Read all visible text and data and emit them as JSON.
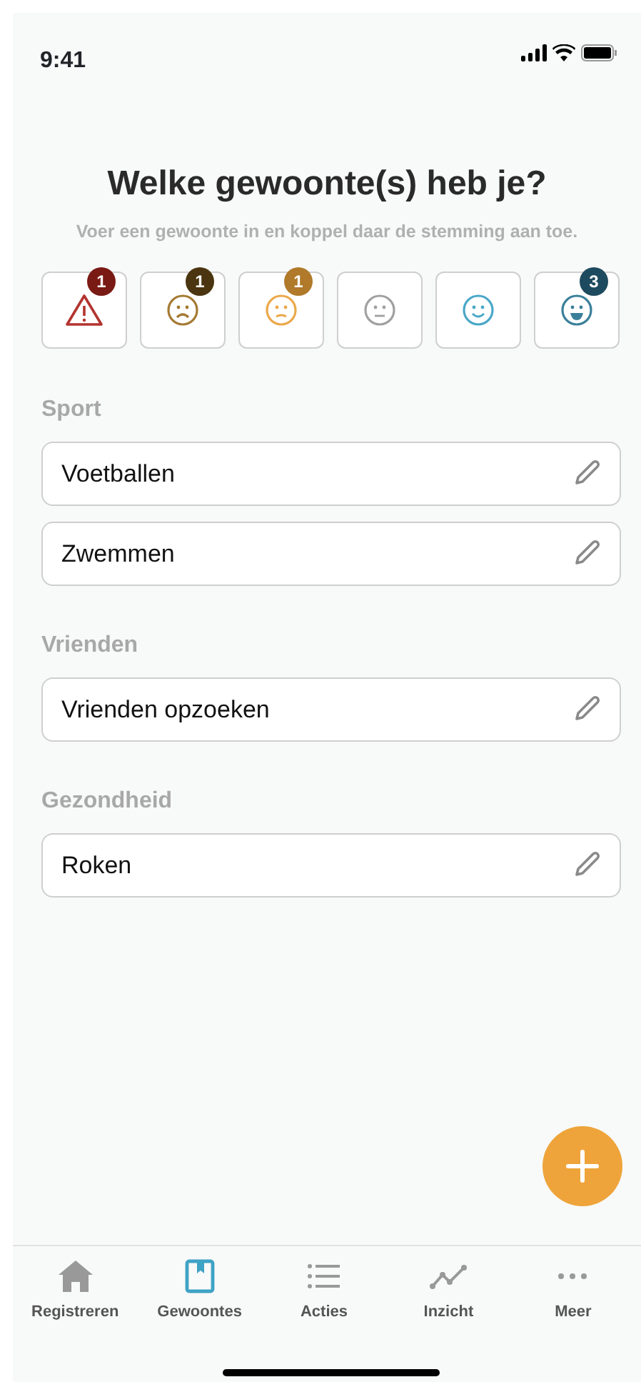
{
  "status_bar": {
    "time": "9:41"
  },
  "title": "Welke gewoonte(s) heb je?",
  "subtitle": "Voer een gewoonte in en koppel daar de stemming aan toe.",
  "moods": [
    {
      "kind": "alert",
      "color": "#b3332e",
      "badge": {
        "count": "1",
        "color": "#7a1a14"
      }
    },
    {
      "kind": "sad",
      "color": "#a57a32",
      "badge": {
        "count": "1",
        "color": "#4a3510"
      }
    },
    {
      "kind": "unhappy",
      "color": "#eba84a",
      "badge": {
        "count": "1",
        "color": "#b07a2a"
      }
    },
    {
      "kind": "neutral",
      "color": "#a0a0a0"
    },
    {
      "kind": "smile",
      "color": "#4aa8c8"
    },
    {
      "kind": "happy",
      "color": "#3a7f9a",
      "badge": {
        "count": "3",
        "color": "#1d4a5e"
      }
    }
  ],
  "groups": [
    {
      "label": "Sport",
      "habits": [
        "Voetballen",
        "Zwemmen"
      ]
    },
    {
      "label": "Vrienden",
      "habits": [
        "Vrienden opzoeken"
      ]
    },
    {
      "label": "Gezondheid",
      "habits": [
        "Roken"
      ]
    }
  ],
  "nav": [
    {
      "kind": "home",
      "label": "Registreren",
      "selected": false
    },
    {
      "kind": "book",
      "label": "Gewoontes",
      "selected": true
    },
    {
      "kind": "list",
      "label": "Acties",
      "selected": false
    },
    {
      "kind": "chart",
      "label": "Inzicht",
      "selected": false
    },
    {
      "kind": "more",
      "label": "Meer",
      "selected": false
    }
  ]
}
